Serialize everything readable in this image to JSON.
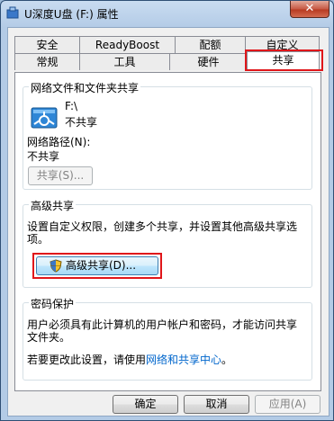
{
  "window": {
    "title": "U深度U盘 (F:) 属性",
    "close_label": "✕"
  },
  "tabs": {
    "row_back": [
      "安全",
      "ReadyBoost",
      "配额",
      "自定义"
    ],
    "row_front": [
      "常规",
      "工具",
      "硬件",
      "共享"
    ],
    "active": "共享"
  },
  "network_sharing": {
    "title": "网络文件和文件夹共享",
    "drive_name": "F:\\",
    "drive_status": "不共享",
    "path_label": "网络路径(N):",
    "path_value": "不共享",
    "share_button": "共享(S)..."
  },
  "advanced_sharing": {
    "title": "高级共享",
    "description_line1": "设置自定义权限，创建多个共享，并设置其他高级共享选",
    "description_line2": "项。",
    "button": "高级共享(D)..."
  },
  "password_protection": {
    "title": "密码保护",
    "description_line1": "用户必须具有此计算机的用户帐户和密码，才能访问共享",
    "description_line2": "文件夹。",
    "change_prefix": "若要更改此设置，请使用",
    "link": "网络和共享中心",
    "change_suffix": "。"
  },
  "footer": {
    "ok": "确定",
    "cancel": "取消",
    "apply": "应用(A)"
  }
}
